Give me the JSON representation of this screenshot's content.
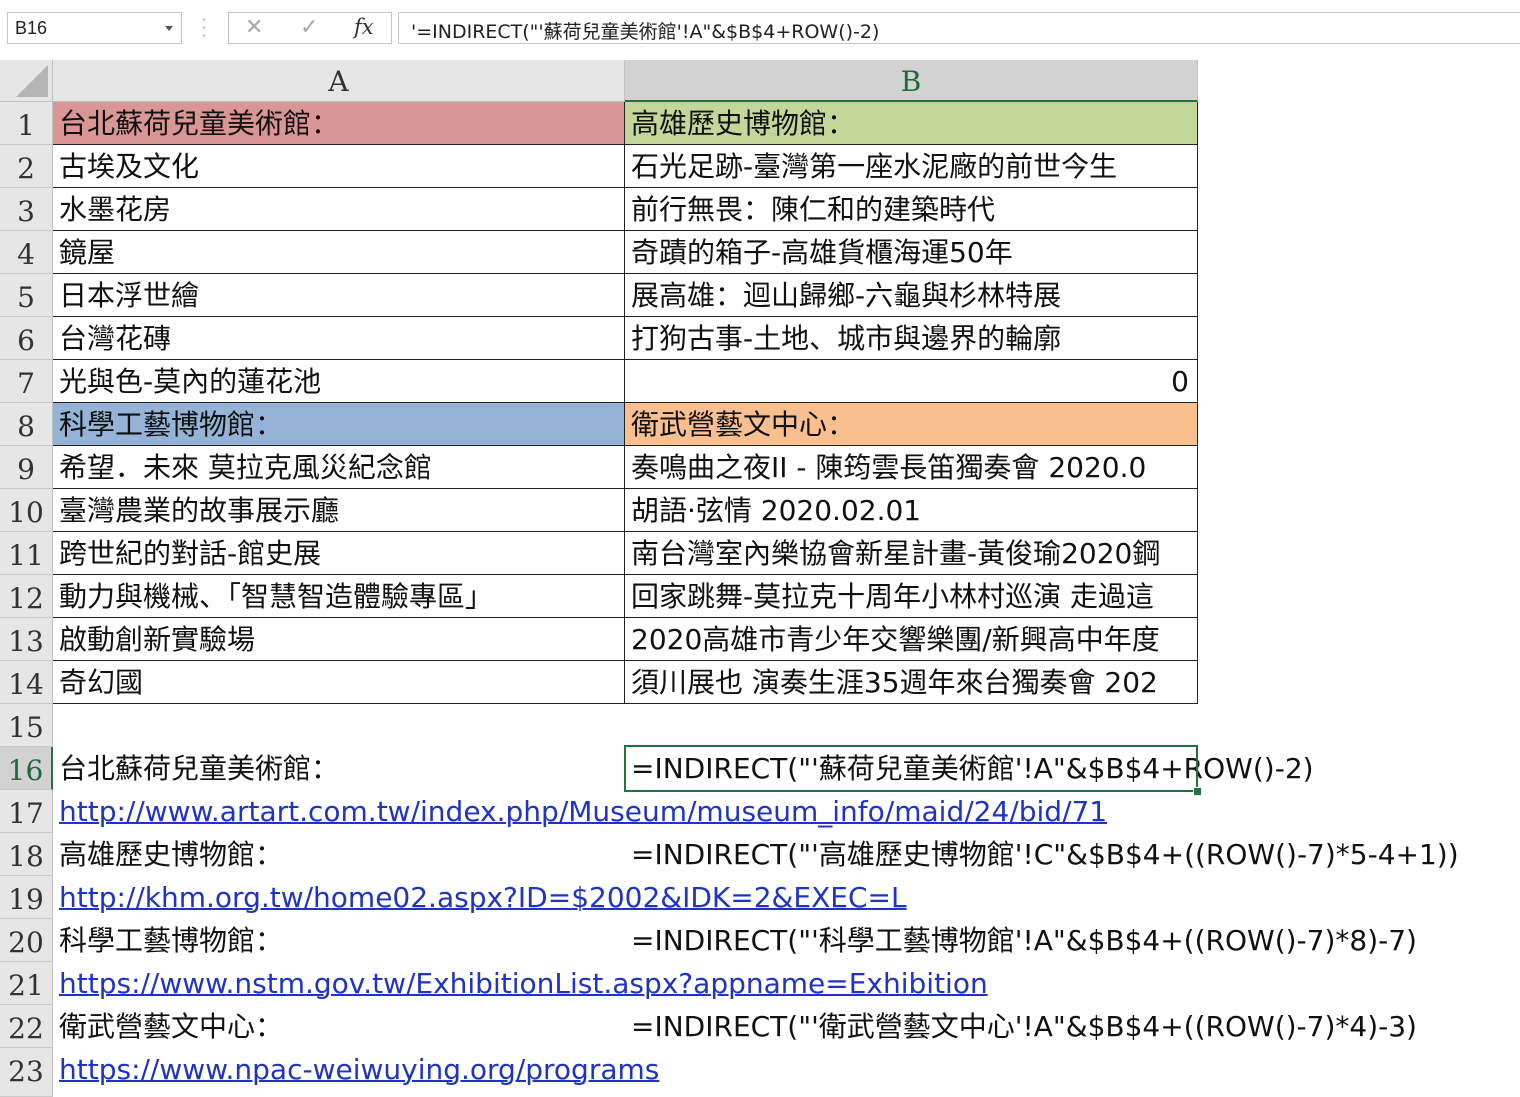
{
  "formula_bar": {
    "name_box": "B16",
    "cancel_icon": "✕",
    "enter_icon": "✓",
    "fx_label": "fx",
    "formula": "'=INDIRECT(\"'蘇荷兒童美術館'!A\"&$B$4+ROW()-2)"
  },
  "columns": [
    "A",
    "B"
  ],
  "rows": [
    "1",
    "2",
    "3",
    "4",
    "5",
    "6",
    "7",
    "8",
    "9",
    "10",
    "11",
    "12",
    "13",
    "14",
    "15",
    "16",
    "17",
    "18",
    "19",
    "20",
    "21",
    "22",
    "23"
  ],
  "colors": {
    "header_red": "#da9694",
    "header_green": "#c4d79b",
    "header_blue": "#95b3d7",
    "header_orange": "#fabf8f",
    "selection_green": "#217346",
    "link_blue": "#1f33c8"
  },
  "table": {
    "a1": "台北蘇荷兒童美術館：",
    "b1": "高雄歷史博物館：",
    "a2": "古埃及文化",
    "b2": "石光足跡-臺灣第一座水泥廠的前世今生",
    "a3": "水墨花房",
    "b3": "前行無畏：陳仁和的建築時代",
    "a4": "鏡屋",
    "b4": "奇蹟的箱子-高雄貨櫃海運50年",
    "a5": "日本浮世繪",
    "b5": "展高雄：迴山歸鄉-六龜與杉林特展",
    "a6": "台灣花磚",
    "b6": "打狗古事-土地、城市與邊界的輪廓",
    "a7": "光與色-莫內的蓮花池",
    "b7": "0",
    "a8": "科學工藝博物館：",
    "b8": "衛武營藝文中心：",
    "a9": "希望．未來 莫拉克風災紀念館",
    "b9": "奏鳴曲之夜II - 陳筠雲長笛獨奏會  2020.0",
    "a10": "臺灣農業的故事展示廳",
    "b10": "胡語·弦情  2020.02.01",
    "a11": "跨世紀的對話-館史展",
    "b11": "南台灣室內樂協會新星計畫-黃俊瑜2020鋼",
    "a12": "動力與機械、「智慧智造體驗專區」",
    "b12": "回家跳舞-莫拉克十周年小林村巡演 走過這",
    "a13": "啟動創新實驗場",
    "b13": "2020高雄市青少年交響樂團/新興高中年度",
    "a14": "奇幻國",
    "b14": "須川展也 演奏生涯35週年來台獨奏會  202"
  },
  "notes": {
    "a16": "台北蘇荷兒童美術館：",
    "b16": "=INDIRECT(\"'蘇荷兒童美術館'!A\"&$B$4+ROW()-2)",
    "a17": "http://www.artart.com.tw/index.php/Museum/museum_info/maid/24/bid/71",
    "a18": "高雄歷史博物館：",
    "b18": "=INDIRECT(\"'高雄歷史博物館'!C\"&$B$4+((ROW()-7)*5-4+1))",
    "a19": "http://khm.org.tw/home02.aspx?ID=$2002&IDK=2&EXEC=L",
    "a20": "科學工藝博物館：",
    "b20": "=INDIRECT(\"'科學工藝博物館'!A\"&$B$4+((ROW()-7)*8)-7)",
    "a21": "https://www.nstm.gov.tw/ExhibitionList.aspx?appname=Exhibition",
    "a22": "衛武營藝文中心：",
    "b22": "=INDIRECT(\"'衛武營藝文中心'!A\"&$B$4+((ROW()-7)*4)-3)",
    "a23": "https://www.npac-weiwuying.org/programs"
  }
}
